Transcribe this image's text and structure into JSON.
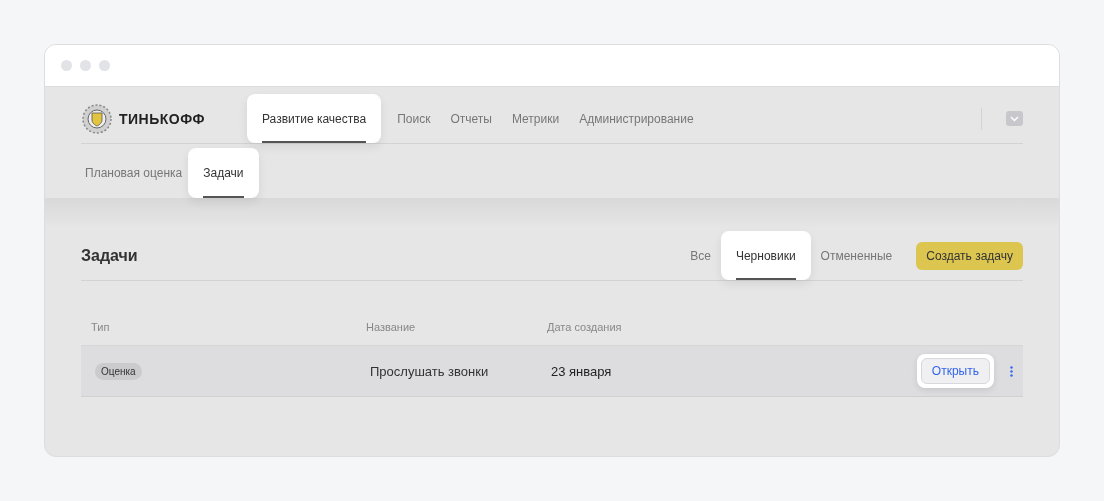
{
  "logo": {
    "text": "ТИНЬКОФФ"
  },
  "nav": [
    {
      "label": "Развитие качества",
      "selected": true
    },
    {
      "label": "Поиск",
      "selected": false
    },
    {
      "label": "Отчеты",
      "selected": false
    },
    {
      "label": "Метрики",
      "selected": false
    },
    {
      "label": "Администрирование",
      "selected": false
    }
  ],
  "subnav": [
    {
      "label": "Плановая оценка",
      "selected": false
    },
    {
      "label": "Задачи",
      "selected": true
    }
  ],
  "page": {
    "title": "Задачи",
    "filters": [
      {
        "label": "Все",
        "selected": false
      },
      {
        "label": "Черновики",
        "selected": true
      },
      {
        "label": "Отмененные",
        "selected": false
      }
    ],
    "create_button": "Создать задачу"
  },
  "table": {
    "columns": [
      "Тип",
      "Название",
      "Дата создания"
    ],
    "rows": [
      {
        "type": "Оценка",
        "name": "Прослушать звонки",
        "date": "23 января",
        "action": "Открыть"
      }
    ]
  }
}
